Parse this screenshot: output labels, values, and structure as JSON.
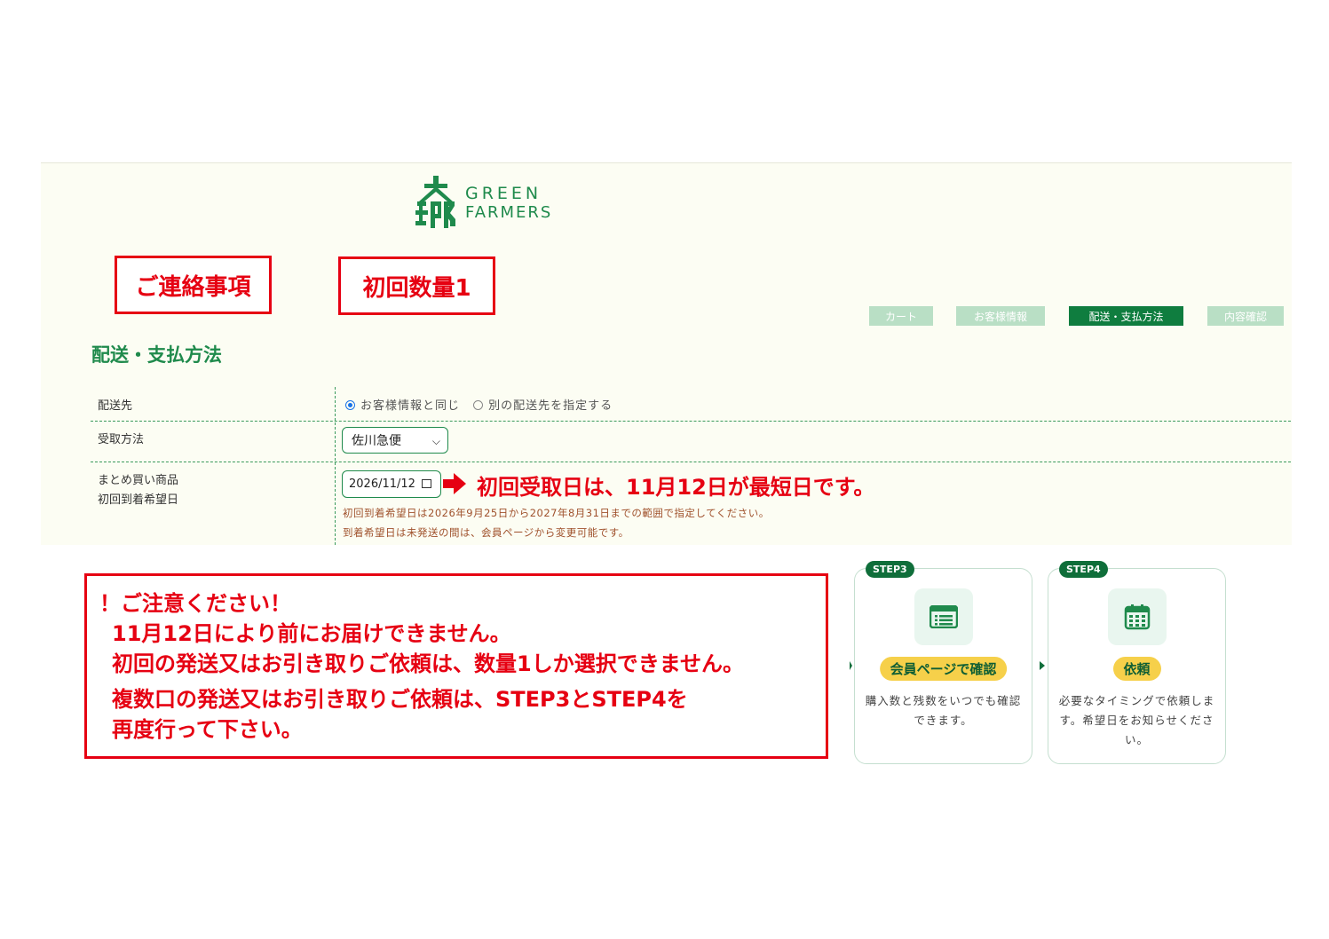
{
  "logo": {
    "line1": "GREEN",
    "line2": "FARMERS"
  },
  "annotations": {
    "box1": "ご連絡事項",
    "box2": "初回数量1",
    "first_date_note": "初回受取日は、11月12日が最短日です。"
  },
  "steps_nav": [
    {
      "label": "カート",
      "active": false
    },
    {
      "label": "お客様情報",
      "active": false
    },
    {
      "label": "配送・支払方法",
      "active": true
    },
    {
      "label": "内容確認",
      "active": false
    }
  ],
  "section_title": "配送・支払方法",
  "form": {
    "destination": {
      "label": "配送先",
      "option1": "お客様情報と同じ",
      "option2": "別の配送先を指定する",
      "selected": "option1"
    },
    "receive_method": {
      "label": "受取方法",
      "value": "佐川急便"
    },
    "first_arrival": {
      "label_line1": "まとめ買い商品",
      "label_line2": "初回到着希望日",
      "value": "2026/11/12",
      "note1": "初回到着希望日は2026年9月25日から2027年8月31日までの範囲で指定してください。",
      "note2": "到着希望日は未発送の間は、会員ページから変更可能です。"
    }
  },
  "caution": {
    "line1": "！ご注意ください！",
    "line2": "11月12日により前にお届けできません。",
    "line3": "初回の発送又はお引き取りご依頼は、数量1しか選択できません。",
    "line4": "複数口の発送又はお引き取りご依頼は、STEP3とSTEP4を",
    "line5": "再度行って下さい。"
  },
  "cards": [
    {
      "badge": "STEP3",
      "icon": "list-icon",
      "pill": "会員ページで確認",
      "text": "購入数と残数をいつでも確認できます。"
    },
    {
      "badge": "STEP4",
      "icon": "calendar-icon",
      "pill": "依頼",
      "text": "必要なタイミングで依頼します。希望日をお知らせください。"
    }
  ],
  "colors": {
    "brand_green": "#1f8a4c",
    "dark_green": "#0f7d3f",
    "alert_red": "#e60012",
    "pill_yellow": "#f6d04a"
  }
}
